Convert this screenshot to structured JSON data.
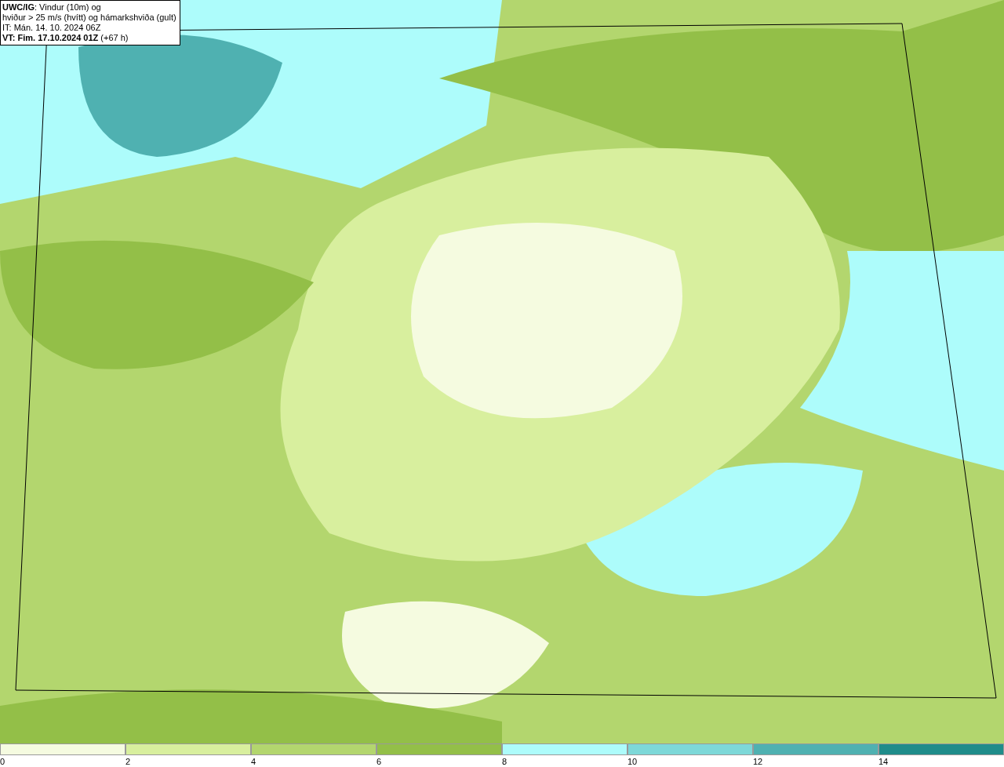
{
  "title_box": {
    "lines": [
      "**UWC/IG**: Vindur (10m) og",
      "hviður > 25 m/s (hvítt) og hámarkshviða (gult)",
      "IT: Mán. 14. 10. 2024 06Z",
      "**VT: Fim. 17.10.2024 01Z** (+67 h)"
    ]
  },
  "legend": {
    "segments": [
      {
        "label": "0",
        "color": "#f5fbe0"
      },
      {
        "label": "2",
        "color": "#d8ef9e"
      },
      {
        "label": "4",
        "color": "#b3d66e"
      },
      {
        "label": "6",
        "color": "#93bf48"
      },
      {
        "label": "8",
        "color": "#adfcfb"
      },
      {
        "label": "10",
        "color": "#7dd8d8"
      },
      {
        "label": "12",
        "color": "#4fb1b1"
      },
      {
        "label": "14",
        "color": "#1f8c8a"
      }
    ]
  }
}
